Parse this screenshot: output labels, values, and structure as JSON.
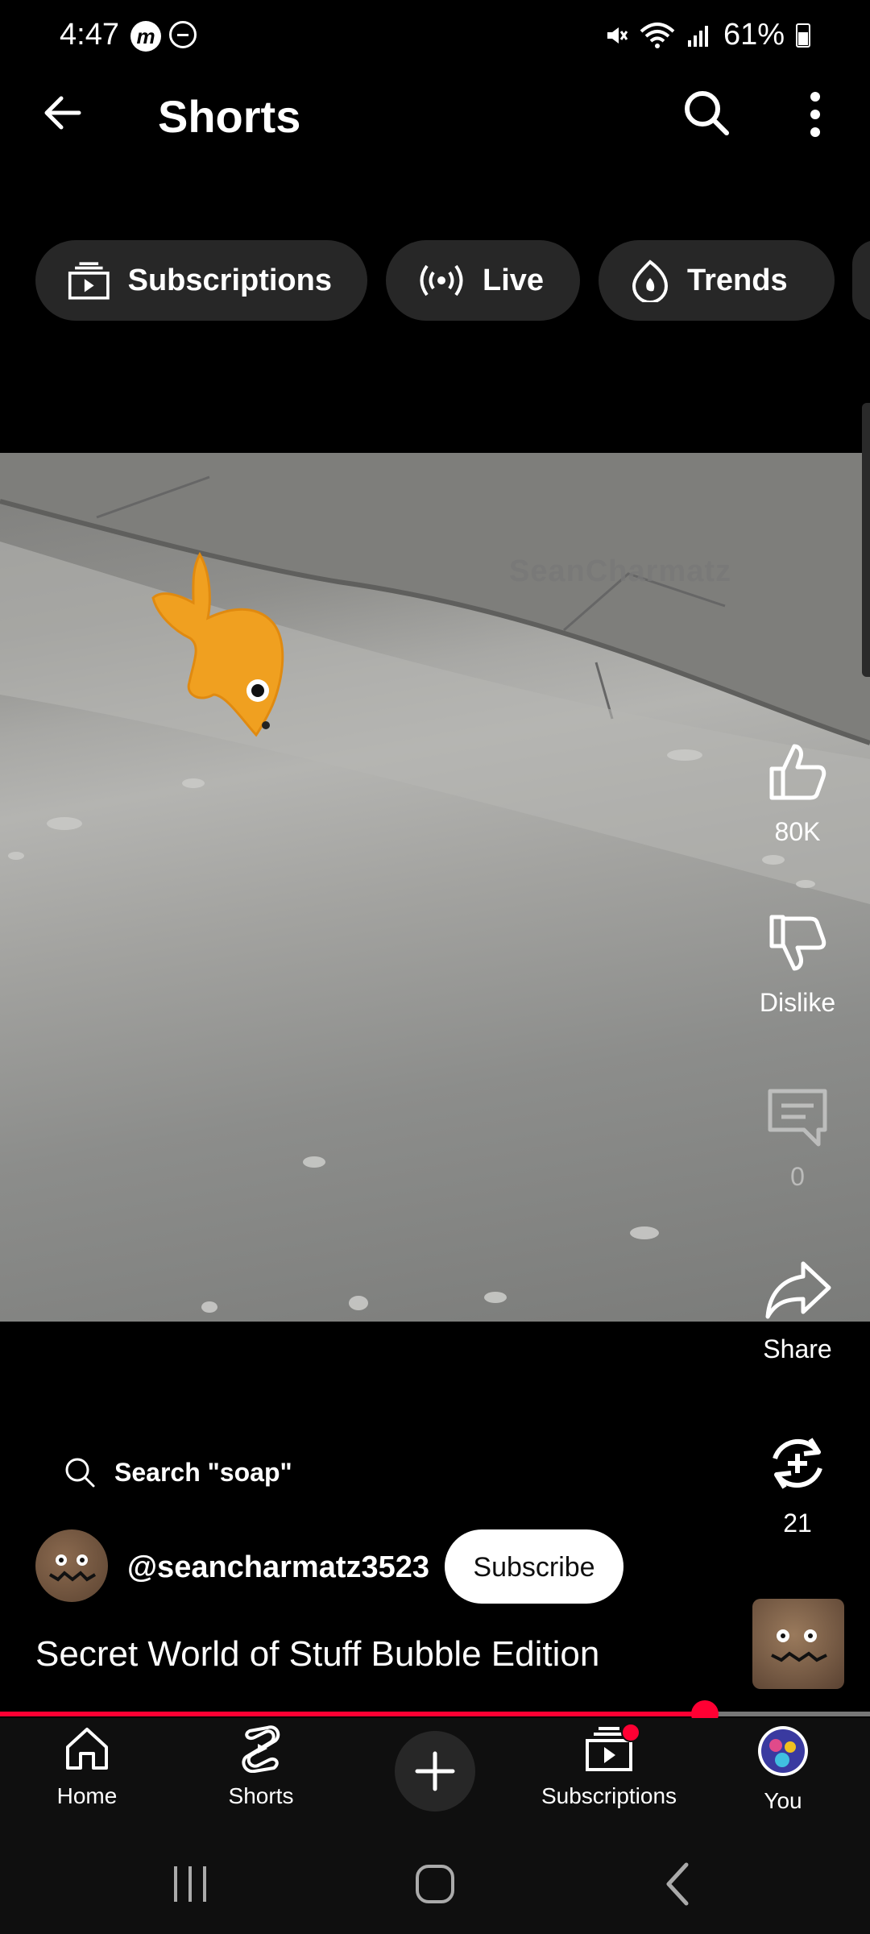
{
  "status_bar": {
    "time": "4:47",
    "battery": "61%",
    "icons": [
      "m-app-icon",
      "dnd-icon",
      "mute-icon",
      "wifi-icon",
      "signal-icon",
      "battery-icon"
    ]
  },
  "header": {
    "title": "Shorts",
    "icons": [
      "back-icon",
      "search-icon",
      "more-vert-icon"
    ]
  },
  "chips": [
    {
      "label": "Subscriptions",
      "icon": "subscriptions-icon"
    },
    {
      "label": "Live",
      "icon": "live-icon"
    },
    {
      "label": "Trends",
      "icon": "trends-icon"
    }
  ],
  "video": {
    "watermark": "SeanCharmatz"
  },
  "actions": {
    "like": "80K",
    "dislike": "Dislike",
    "comments": "0",
    "share": "Share",
    "remix": "21"
  },
  "search_suggestion": "Search \"soap\"",
  "channel": {
    "handle": "@seancharmatz3523",
    "subscribe": "Subscribe"
  },
  "short_title": "Secret World of Stuff Bubble Edition",
  "progress": 0.81,
  "bottom_nav": [
    {
      "label": "Home",
      "icon": "home-icon"
    },
    {
      "label": "Shorts",
      "icon": "shorts-icon"
    },
    {
      "label": "",
      "icon": "create-icon"
    },
    {
      "label": "Subscriptions",
      "icon": "subscriptions-icon"
    },
    {
      "label": "You",
      "icon": "you-avatar"
    }
  ],
  "colors": {
    "accent": "#ff0033",
    "chip_bg": "#272727",
    "nav_bg": "#0f0f0f"
  }
}
